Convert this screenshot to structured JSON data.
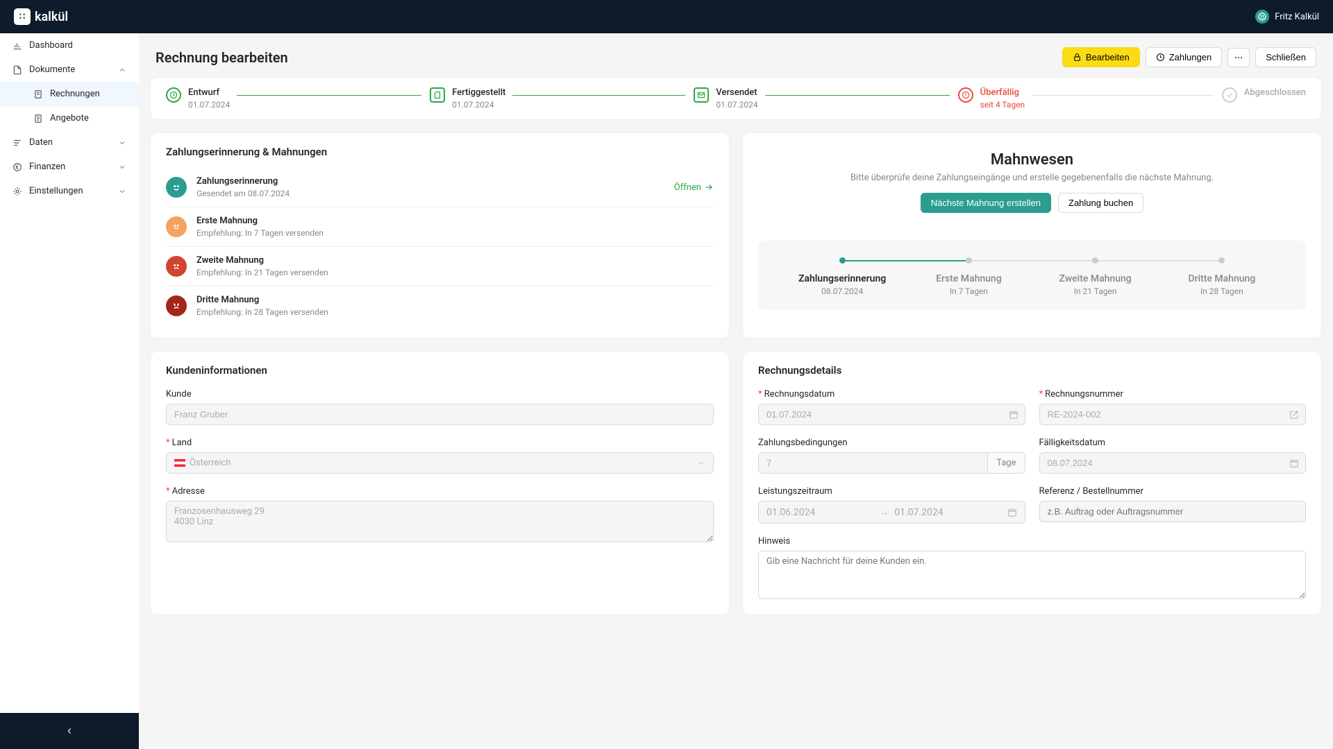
{
  "brand": "kalkül",
  "user": {
    "name": "Fritz Kalkül"
  },
  "sidebar": {
    "dashboard": "Dashboard",
    "documents": "Dokumente",
    "invoices": "Rechnungen",
    "offers": "Angebote",
    "data": "Daten",
    "finance": "Finanzen",
    "settings": "Einstellungen"
  },
  "page": {
    "title": "Rechnung bearbeiten",
    "edit": "Bearbeiten",
    "payments": "Zahlungen",
    "close": "Schließen"
  },
  "status": {
    "draft": {
      "label": "Entwurf",
      "date": "01.07.2024"
    },
    "done": {
      "label": "Fertiggestellt",
      "date": "01.07.2024"
    },
    "sent": {
      "label": "Versendet",
      "date": "01.07.2024"
    },
    "overdue": {
      "label": "Überfällig",
      "sub": "seit 4 Tagen"
    },
    "closed": {
      "label": "Abgeschlossen"
    }
  },
  "dunning": {
    "title": "Zahlungserinnerung & Mahnungen",
    "open": "Öffnen",
    "items": [
      {
        "title": "Zahlungserinnerung",
        "sub": "Gesendet am 08.07.2024"
      },
      {
        "title": "Erste Mahnung",
        "sub": "Empfehlung: In 7 Tagen versenden"
      },
      {
        "title": "Zweite Mahnung",
        "sub": "Empfehlung: In 21 Tagen versenden"
      },
      {
        "title": "Dritte Mahnung",
        "sub": "Empfehlung: In 28 Tagen versenden"
      }
    ]
  },
  "mahnwesen": {
    "title": "Mahnwesen",
    "desc": "Bitte überprüfe deine Zahlungseingänge und erstelle gegebenenfalls die nächste Mahnung.",
    "create": "Nächste Mahnung erstellen",
    "book": "Zahlung buchen",
    "steps": [
      {
        "label": "Zahlungserinnerung",
        "sub": "08.07.2024"
      },
      {
        "label": "Erste Mahnung",
        "sub": "In 7 Tagen"
      },
      {
        "label": "Zweite Mahnung",
        "sub": "In 21 Tagen"
      },
      {
        "label": "Dritte Mahnung",
        "sub": "In 28 Tagen"
      }
    ]
  },
  "customer": {
    "title": "Kundeninformationen",
    "labels": {
      "customer": "Kunde",
      "country": "Land",
      "address": "Adresse"
    },
    "name": "Franz Gruber",
    "country": "Österreich",
    "address": "Franzosenhausweg 29\n4030 Linz"
  },
  "details": {
    "title": "Rechnungsdetails",
    "labels": {
      "date": "Rechnungsdatum",
      "number": "Rechnungsnummer",
      "terms": "Zahlungsbedingungen",
      "due": "Fälligkeitsdatum",
      "period": "Leistungszeitraum",
      "reference": "Referenz / Bestellnummer",
      "note": "Hinweis",
      "days": "Tage"
    },
    "date": "01.07.2024",
    "number": "RE-2024-002",
    "terms": "7",
    "due": "08.07.2024",
    "period_from": "01.06.2024",
    "period_to": "01.07.2024",
    "reference_ph": "z.B. Auftrag oder Auftragsnummer",
    "note_ph": "Gib eine Nachricht für deine Kunden ein."
  }
}
